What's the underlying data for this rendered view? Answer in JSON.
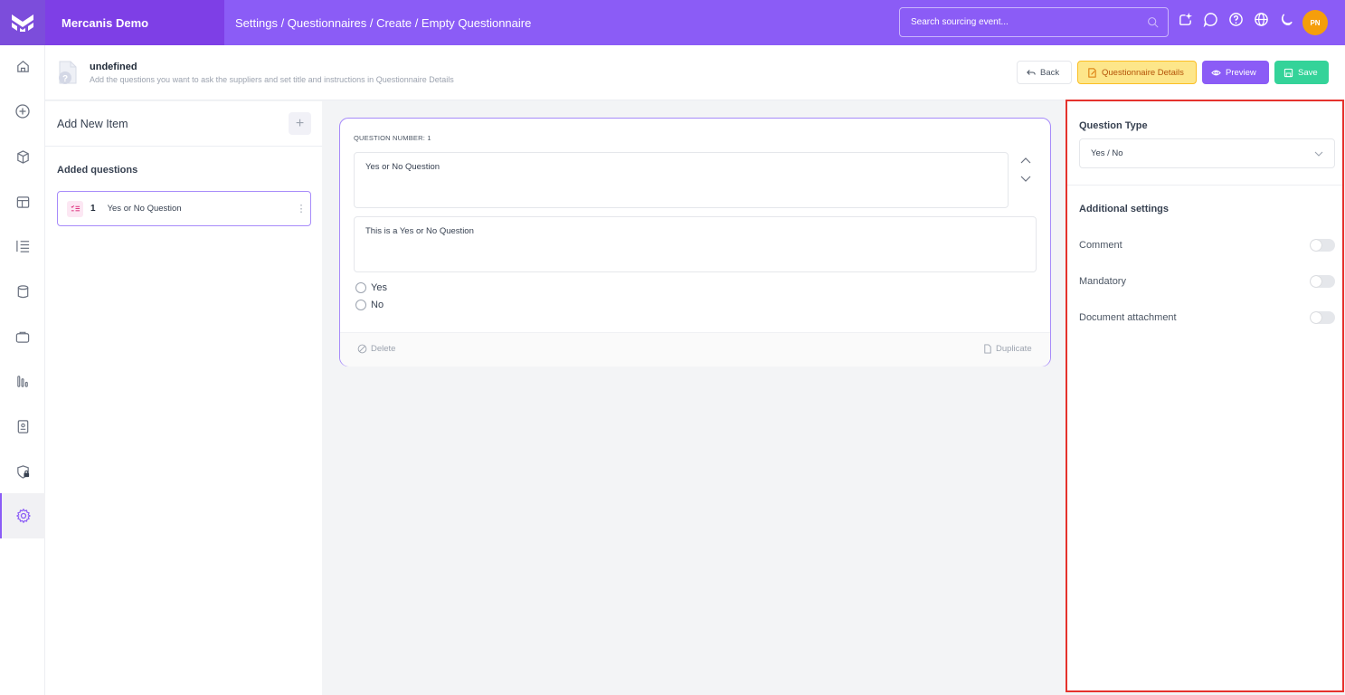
{
  "app": {
    "brand": "Mercanis Demo",
    "breadcrumb": "Settings / Questionnaires / Create / Empty Questionnaire"
  },
  "search": {
    "placeholder": "Search sourcing event..."
  },
  "user": {
    "initials": "PN",
    "avatar_color": "#f59e0b"
  },
  "colors": {
    "accent": "#8b5cf6",
    "highlight_border": "#e5322d"
  },
  "sidebar": {
    "items": [
      {
        "icon": "home-icon"
      },
      {
        "icon": "plus-circle-icon"
      },
      {
        "icon": "cube-icon"
      },
      {
        "icon": "layout-icon"
      },
      {
        "icon": "list-icon"
      },
      {
        "icon": "database-icon"
      },
      {
        "icon": "briefcase-icon"
      },
      {
        "icon": "bar-chart-icon"
      },
      {
        "icon": "contact-icon"
      },
      {
        "icon": "shield-lock-icon"
      },
      {
        "icon": "gear-icon",
        "active": true
      }
    ]
  },
  "header": {
    "title": "undefined",
    "description": "Add the questions you want to ask the suppliers and set title and instructions in Questionnaire Details",
    "back_label": "Back",
    "details_label": "Questionnaire Details",
    "preview_label": "Preview",
    "save_label": "Save"
  },
  "left_panel": {
    "add_item_label": "Add New Item",
    "add_button": "+",
    "added_questions_label": "Added questions",
    "questions": [
      {
        "number": "1",
        "label": "Yes or No Question",
        "menu": "⋮"
      }
    ]
  },
  "question_card": {
    "question_number_label": "QUESTION NUMBER: 1",
    "question_text": "Yes or No Question",
    "description_text": "This is a Yes or No Question",
    "options": [
      "Yes",
      "No"
    ],
    "delete_label": "Delete",
    "duplicate_label": "Duplicate"
  },
  "right_panel": {
    "question_type_label": "Question Type",
    "question_type_value": "Yes / No",
    "additional_settings_label": "Additional settings",
    "settings": [
      {
        "label": "Comment",
        "enabled": false
      },
      {
        "label": "Mandatory",
        "enabled": false
      },
      {
        "label": "Document attachment",
        "enabled": false
      }
    ]
  }
}
